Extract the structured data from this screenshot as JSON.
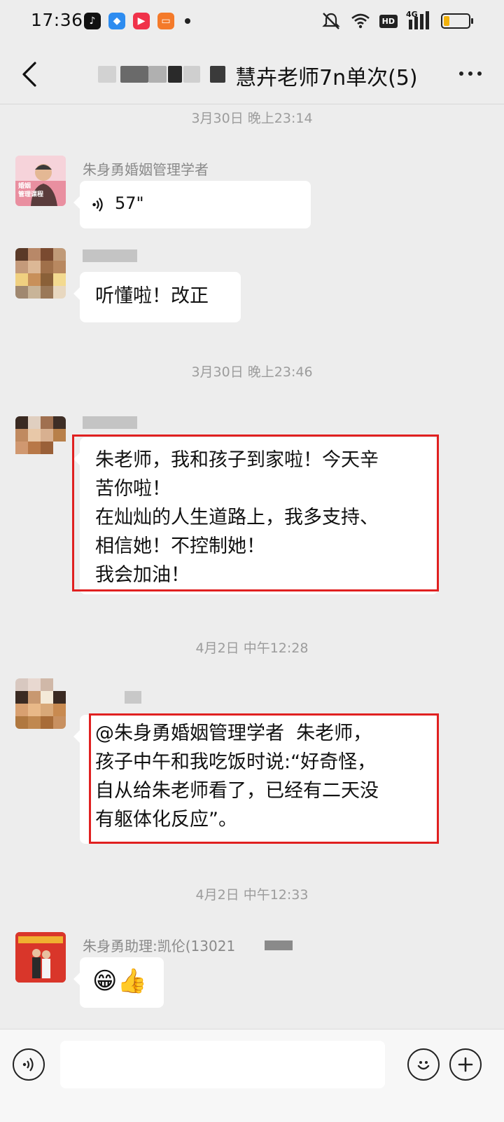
{
  "status_bar": {
    "time": "17:36",
    "network": "4G",
    "hd": "HD"
  },
  "header": {
    "title": "慧卉老师7n单次(5)"
  },
  "messages": [
    {
      "timestamp": "3月30日 晚上23:14"
    },
    {
      "sender": "朱身勇婚姻管理学者",
      "voice_duration": "57\""
    },
    {
      "text": "听懂啦！改正"
    },
    {
      "timestamp": "3月30日 晚上23:46"
    },
    {
      "text": "朱老师，我和孩子到家啦！今天辛\n苦你啦！\n在灿灿的人生道路上，我多支持、\n相信她！不控制她！\n我会加油！"
    },
    {
      "timestamp": "4月2日 中午12:28"
    },
    {
      "text": "@朱身勇婚姻管理学者  朱老师，\n孩子中午和我吃饭时说:“好奇怪，\n自从给朱老师看了，已经有二天没\n有躯体化反应”。"
    },
    {
      "timestamp": "4月2日 中午12:33"
    },
    {
      "sender": "朱身勇助理:凯伦(13021",
      "text": "😁👍"
    }
  ],
  "avatar_labels": {
    "teacher_badge_1": "婚姻",
    "teacher_badge_2": "管理课程"
  },
  "colors": {
    "background": "#ededed",
    "bubble": "#ffffff",
    "highlight": "#e02020",
    "timestamp": "#9c9c9c"
  }
}
